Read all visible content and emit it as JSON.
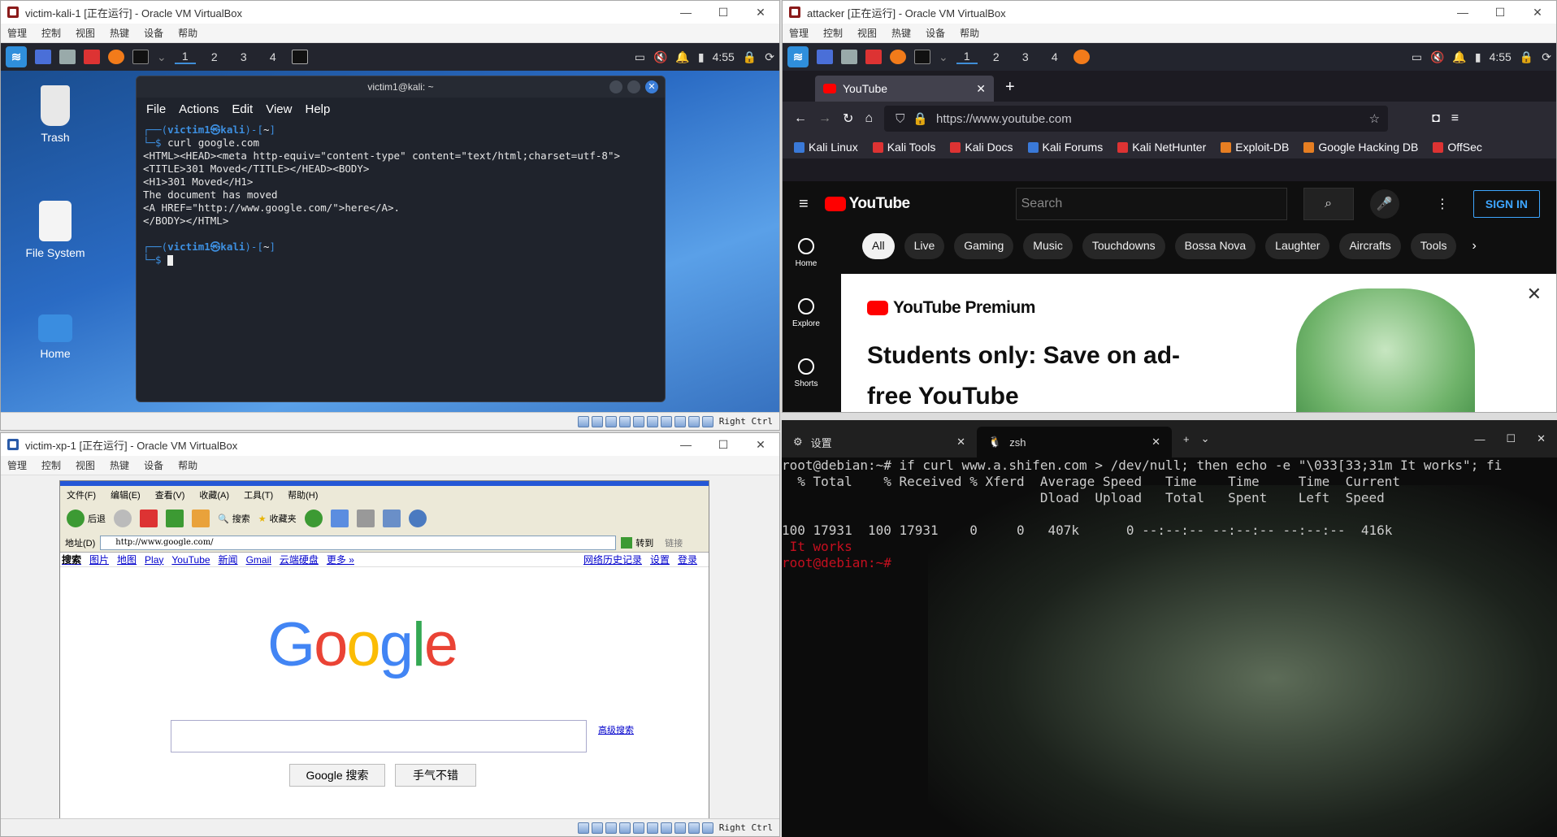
{
  "vm1": {
    "title": "victim-kali-1 [正在运行] - Oracle VM VirtualBox",
    "menu": [
      "管理",
      "控制",
      "视图",
      "热键",
      "设备",
      "帮助"
    ],
    "workspaces": [
      "1",
      "2",
      "3",
      "4"
    ],
    "time": "4:55",
    "desktop": [
      "Trash",
      "File System",
      "Home"
    ],
    "terminal": {
      "title": "victim1@kali: ~",
      "menu": [
        "File",
        "Actions",
        "Edit",
        "View",
        "Help"
      ],
      "l1_user": "victim1㉿kali",
      "l1_dir": "~",
      "cmd": "curl google.com",
      "out": "<HTML><HEAD><meta http-equiv=\"content-type\" content=\"text/html;charset=utf-8\">\n<TITLE>301 Moved</TITLE></HEAD><BODY>\n<H1>301 Moved</H1>\nThe document has moved\n<A HREF=\"http://www.google.com/\">here</A>.\n</BODY></HTML>"
    },
    "hostkey": "Right Ctrl"
  },
  "vm2": {
    "title": "attacker [正在运行] - Oracle VM VirtualBox",
    "menu": [
      "管理",
      "控制",
      "视图",
      "热键",
      "设备",
      "帮助"
    ],
    "workspaces": [
      "1",
      "2",
      "3",
      "4"
    ],
    "time": "4:55",
    "tab": "YouTube",
    "url": "https://www.youtube.com",
    "bookmarks": [
      "Kali Linux",
      "Kali Tools",
      "Kali Docs",
      "Kali Forums",
      "Kali NetHunter",
      "Exploit-DB",
      "Google Hacking DB",
      "OffSec"
    ],
    "yt": {
      "logo": "YouTube",
      "search": "Search",
      "signin": "SIGN IN",
      "side": [
        "Home",
        "Explore",
        "Shorts"
      ],
      "chips": [
        "All",
        "Live",
        "Gaming",
        "Music",
        "Touchdowns",
        "Bossa Nova",
        "Laughter",
        "Aircrafts",
        "Tools"
      ],
      "premium": "YouTube Premium",
      "promo": "Students only: Save on ad-free YouTube"
    }
  },
  "zsh": {
    "tabs": [
      "设置",
      "zsh"
    ],
    "line1": "root@debian:~# if curl www.a.shifen.com > /dev/null; then echo -e \"\\033[33;31m It works\"; fi",
    "hdr1": "  % Total    % Received % Xferd  Average Speed   Time    Time     Time  Current",
    "hdr2": "                                 Dload  Upload   Total   Spent    Left  Speed",
    "row": "100 17931  100 17931    0     0   407k      0 --:--:-- --:--:-- --:--:--  416k",
    "works": " It works",
    "prompt": "root@debian:~#"
  },
  "vm3": {
    "title": "victim-xp-1 [正在运行] - Oracle VM VirtualBox",
    "menu": [
      "管理",
      "控制",
      "视图",
      "热键",
      "设备",
      "帮助"
    ],
    "ie_menu": [
      "文件(F)",
      "编辑(E)",
      "查看(V)",
      "收藏(A)",
      "工具(T)",
      "帮助(H)"
    ],
    "back": "后退",
    "search": "搜索",
    "fav": "收藏夹",
    "addr_label": "地址(D)",
    "addr": "http://www.google.com/",
    "go": "转到",
    "links": "链接",
    "glinks": [
      "搜索",
      "图片",
      "地图",
      "Play",
      "YouTube",
      "新闻",
      "Gmail",
      "云端硬盘",
      "更多 »"
    ],
    "gright": [
      "网络历史记录",
      "设置",
      "登录"
    ],
    "adv": "高级搜索",
    "btn1": "Google 搜索",
    "btn2": "手气不错"
  }
}
